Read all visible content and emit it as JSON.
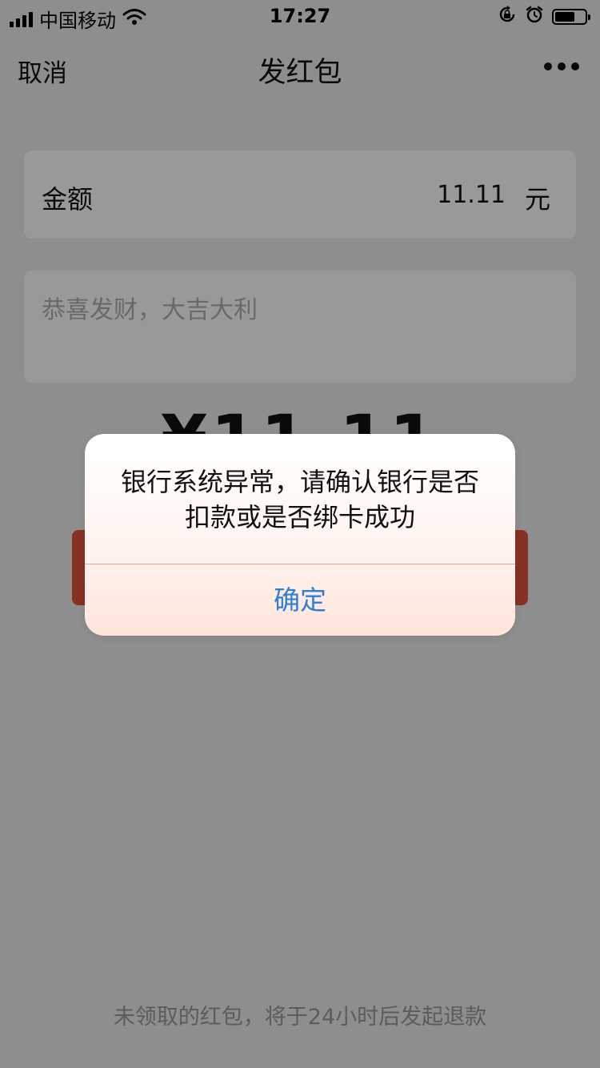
{
  "status_bar": {
    "carrier": "中国移动",
    "time": "17:27"
  },
  "nav": {
    "cancel": "取消",
    "title": "发红包"
  },
  "amount_row": {
    "label": "金额",
    "value": "11.11",
    "unit": "元"
  },
  "greeting": {
    "placeholder": "恭喜发财，大吉大利"
  },
  "big_amount": "¥11.11",
  "footer_note": "未领取的红包，将于24小时后发起退款",
  "dialog": {
    "message": "银行系统异常，请确认银行是否扣款或是否绑卡成功",
    "confirm": "确定"
  },
  "icons": {
    "signal": "signal-icon",
    "wifi": "wifi-icon",
    "rotation_lock": "rotation-lock-icon",
    "alarm": "alarm-icon",
    "battery": "battery-icon",
    "more": "more-icon"
  },
  "colors": {
    "send_button": "#e0533d",
    "confirm_text": "#2f7fd8",
    "divider": "#f0a490"
  }
}
